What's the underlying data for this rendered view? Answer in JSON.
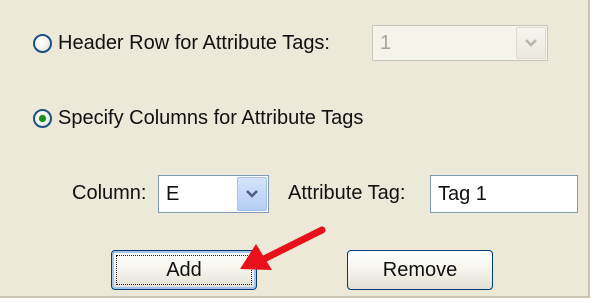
{
  "options": {
    "header_row": {
      "label": "Header Row for Attribute Tags:",
      "selected": false,
      "dropdown_value": "1",
      "dropdown_enabled": false
    },
    "specify_columns": {
      "label": "Specify Columns for Attribute Tags",
      "selected": true
    }
  },
  "column": {
    "label": "Column:",
    "value": "E"
  },
  "attribute_tag": {
    "label": "Attribute Tag:",
    "value": "Tag 1"
  },
  "buttons": {
    "add": "Add",
    "remove": "Remove"
  },
  "icons": {
    "dropdown": "chevron-down-icon",
    "pointer": "red-arrow-icon"
  },
  "colors": {
    "panel_background": "#ece9d8",
    "radio_selected_dot": "#1e8f1e",
    "arrow": "#e8101a",
    "button_border": "#003c74"
  }
}
